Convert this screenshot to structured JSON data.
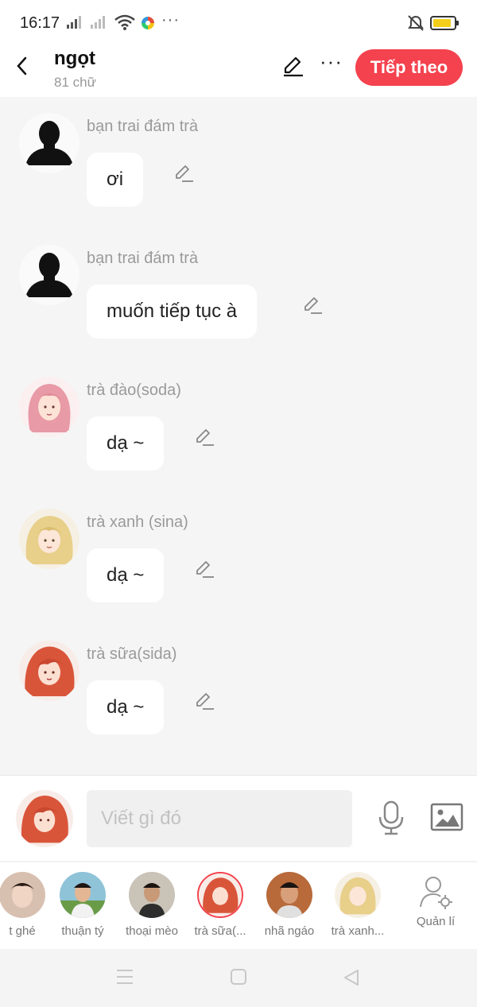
{
  "status": {
    "time": "16:17"
  },
  "header": {
    "title": "ngọt",
    "subtitle": "81 chữ",
    "next_label": "Tiếp theo"
  },
  "messages": [
    {
      "sender": "bạn trai đám trà",
      "text": "ơi"
    },
    {
      "sender": "bạn trai đám trà",
      "text": "muốn tiếp tục à"
    },
    {
      "sender": "trà đào(soda)",
      "text": "dạ ~"
    },
    {
      "sender": "trà xanh (sina)",
      "text": "dạ ~"
    },
    {
      "sender": "trà sữa(sida)",
      "text": "dạ ~"
    }
  ],
  "composer": {
    "placeholder": "Viết gì đó"
  },
  "characters": [
    {
      "name": "t ghé"
    },
    {
      "name": "thuận tý"
    },
    {
      "name": "thoại mèo"
    },
    {
      "name": "trà sữa(..."
    },
    {
      "name": "nhã ngáo"
    },
    {
      "name": "trà xanh..."
    }
  ],
  "manage_label": "Quản lí",
  "colors": {
    "accent": "#f4424e",
    "battery": "#f3cf1b",
    "background": "#f5f5f5"
  }
}
